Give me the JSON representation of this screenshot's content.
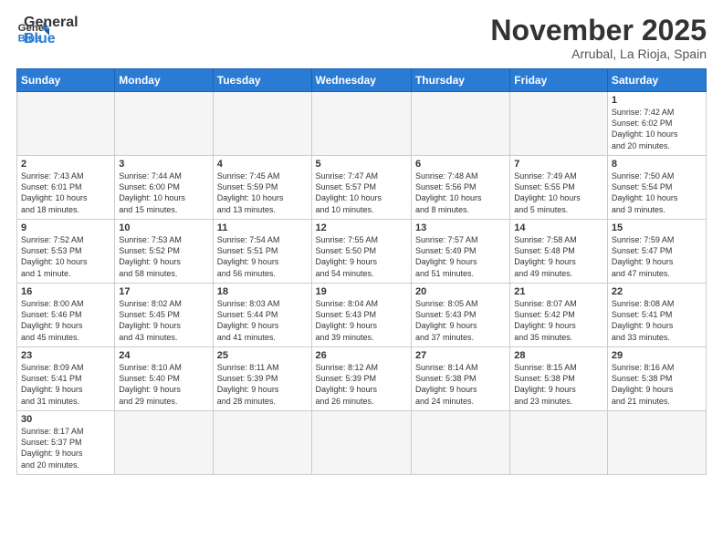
{
  "header": {
    "logo_general": "General",
    "logo_blue": "Blue",
    "month_title": "November 2025",
    "location": "Arrubal, La Rioja, Spain"
  },
  "weekdays": [
    "Sunday",
    "Monday",
    "Tuesday",
    "Wednesday",
    "Thursday",
    "Friday",
    "Saturday"
  ],
  "weeks": [
    [
      {
        "day": "",
        "info": ""
      },
      {
        "day": "",
        "info": ""
      },
      {
        "day": "",
        "info": ""
      },
      {
        "day": "",
        "info": ""
      },
      {
        "day": "",
        "info": ""
      },
      {
        "day": "",
        "info": ""
      },
      {
        "day": "1",
        "info": "Sunrise: 7:42 AM\nSunset: 6:02 PM\nDaylight: 10 hours\nand 20 minutes."
      }
    ],
    [
      {
        "day": "2",
        "info": "Sunrise: 7:43 AM\nSunset: 6:01 PM\nDaylight: 10 hours\nand 18 minutes."
      },
      {
        "day": "3",
        "info": "Sunrise: 7:44 AM\nSunset: 6:00 PM\nDaylight: 10 hours\nand 15 minutes."
      },
      {
        "day": "4",
        "info": "Sunrise: 7:45 AM\nSunset: 5:59 PM\nDaylight: 10 hours\nand 13 minutes."
      },
      {
        "day": "5",
        "info": "Sunrise: 7:47 AM\nSunset: 5:57 PM\nDaylight: 10 hours\nand 10 minutes."
      },
      {
        "day": "6",
        "info": "Sunrise: 7:48 AM\nSunset: 5:56 PM\nDaylight: 10 hours\nand 8 minutes."
      },
      {
        "day": "7",
        "info": "Sunrise: 7:49 AM\nSunset: 5:55 PM\nDaylight: 10 hours\nand 5 minutes."
      },
      {
        "day": "8",
        "info": "Sunrise: 7:50 AM\nSunset: 5:54 PM\nDaylight: 10 hours\nand 3 minutes."
      }
    ],
    [
      {
        "day": "9",
        "info": "Sunrise: 7:52 AM\nSunset: 5:53 PM\nDaylight: 10 hours\nand 1 minute."
      },
      {
        "day": "10",
        "info": "Sunrise: 7:53 AM\nSunset: 5:52 PM\nDaylight: 9 hours\nand 58 minutes."
      },
      {
        "day": "11",
        "info": "Sunrise: 7:54 AM\nSunset: 5:51 PM\nDaylight: 9 hours\nand 56 minutes."
      },
      {
        "day": "12",
        "info": "Sunrise: 7:55 AM\nSunset: 5:50 PM\nDaylight: 9 hours\nand 54 minutes."
      },
      {
        "day": "13",
        "info": "Sunrise: 7:57 AM\nSunset: 5:49 PM\nDaylight: 9 hours\nand 51 minutes."
      },
      {
        "day": "14",
        "info": "Sunrise: 7:58 AM\nSunset: 5:48 PM\nDaylight: 9 hours\nand 49 minutes."
      },
      {
        "day": "15",
        "info": "Sunrise: 7:59 AM\nSunset: 5:47 PM\nDaylight: 9 hours\nand 47 minutes."
      }
    ],
    [
      {
        "day": "16",
        "info": "Sunrise: 8:00 AM\nSunset: 5:46 PM\nDaylight: 9 hours\nand 45 minutes."
      },
      {
        "day": "17",
        "info": "Sunrise: 8:02 AM\nSunset: 5:45 PM\nDaylight: 9 hours\nand 43 minutes."
      },
      {
        "day": "18",
        "info": "Sunrise: 8:03 AM\nSunset: 5:44 PM\nDaylight: 9 hours\nand 41 minutes."
      },
      {
        "day": "19",
        "info": "Sunrise: 8:04 AM\nSunset: 5:43 PM\nDaylight: 9 hours\nand 39 minutes."
      },
      {
        "day": "20",
        "info": "Sunrise: 8:05 AM\nSunset: 5:43 PM\nDaylight: 9 hours\nand 37 minutes."
      },
      {
        "day": "21",
        "info": "Sunrise: 8:07 AM\nSunset: 5:42 PM\nDaylight: 9 hours\nand 35 minutes."
      },
      {
        "day": "22",
        "info": "Sunrise: 8:08 AM\nSunset: 5:41 PM\nDaylight: 9 hours\nand 33 minutes."
      }
    ],
    [
      {
        "day": "23",
        "info": "Sunrise: 8:09 AM\nSunset: 5:41 PM\nDaylight: 9 hours\nand 31 minutes."
      },
      {
        "day": "24",
        "info": "Sunrise: 8:10 AM\nSunset: 5:40 PM\nDaylight: 9 hours\nand 29 minutes."
      },
      {
        "day": "25",
        "info": "Sunrise: 8:11 AM\nSunset: 5:39 PM\nDaylight: 9 hours\nand 28 minutes."
      },
      {
        "day": "26",
        "info": "Sunrise: 8:12 AM\nSunset: 5:39 PM\nDaylight: 9 hours\nand 26 minutes."
      },
      {
        "day": "27",
        "info": "Sunrise: 8:14 AM\nSunset: 5:38 PM\nDaylight: 9 hours\nand 24 minutes."
      },
      {
        "day": "28",
        "info": "Sunrise: 8:15 AM\nSunset: 5:38 PM\nDaylight: 9 hours\nand 23 minutes."
      },
      {
        "day": "29",
        "info": "Sunrise: 8:16 AM\nSunset: 5:38 PM\nDaylight: 9 hours\nand 21 minutes."
      }
    ],
    [
      {
        "day": "30",
        "info": "Sunrise: 8:17 AM\nSunset: 5:37 PM\nDaylight: 9 hours\nand 20 minutes."
      },
      {
        "day": "",
        "info": ""
      },
      {
        "day": "",
        "info": ""
      },
      {
        "day": "",
        "info": ""
      },
      {
        "day": "",
        "info": ""
      },
      {
        "day": "",
        "info": ""
      },
      {
        "day": "",
        "info": ""
      }
    ]
  ]
}
